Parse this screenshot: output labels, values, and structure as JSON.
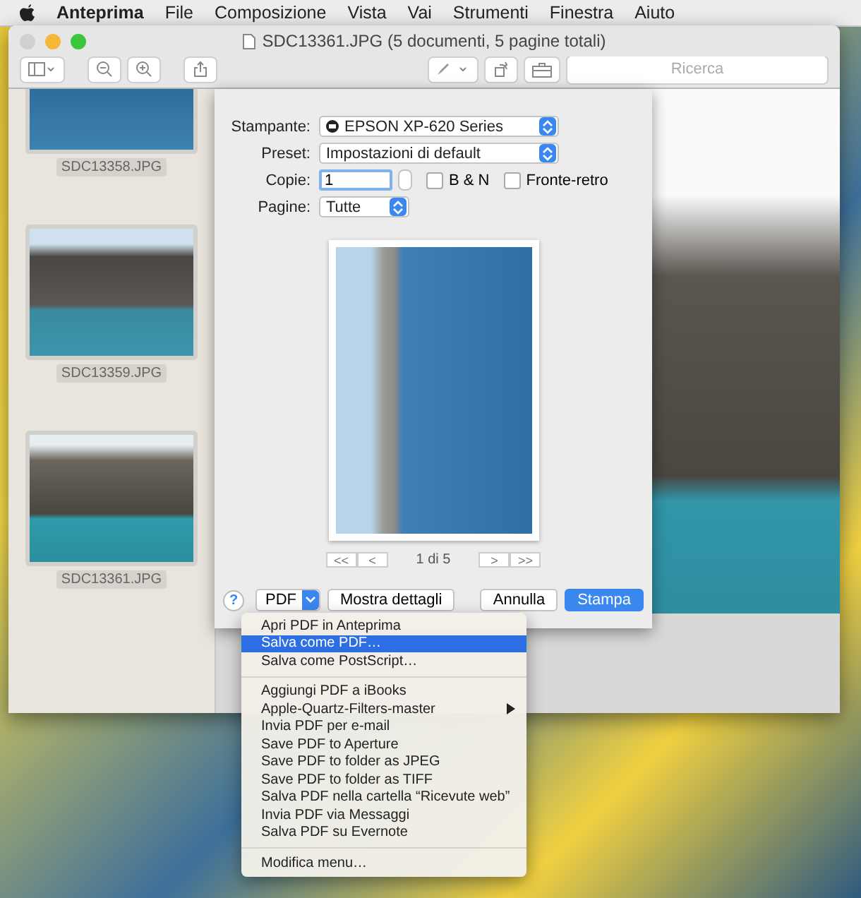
{
  "menubar": {
    "app": "Anteprima",
    "menus": [
      "File",
      "Composizione",
      "Vista",
      "Vai",
      "Strumenti",
      "Finestra",
      "Aiuto"
    ]
  },
  "window": {
    "title": "SDC13361.JPG (5 documenti, 5 pagine totali)",
    "search": {
      "placeholder": "Ricerca"
    }
  },
  "sidebar": {
    "items": [
      {
        "label": "SDC13358.JPG"
      },
      {
        "label": "SDC13359.JPG"
      },
      {
        "label": "SDC13361.JPG"
      }
    ]
  },
  "print": {
    "fields": [
      {
        "label": "Stampante:",
        "kind": "printer",
        "value": "EPSON XP-620 Series"
      },
      {
        "label": "Preset:",
        "kind": "popup",
        "value": "Impostazioni di default"
      },
      {
        "label": "Copie:",
        "kind": "copies",
        "value": "1",
        "checkboxes": [
          {
            "label": "B & N",
            "checked": false
          },
          {
            "label": "Fronte-retro",
            "checked": false
          }
        ]
      },
      {
        "label": "Pagine:",
        "kind": "short",
        "value": "Tutte"
      }
    ],
    "pager": {
      "first": "<<",
      "prev": "<",
      "page": "1 di 5",
      "next": ">",
      "last": ">>"
    },
    "help": "?",
    "pdf": "PDF",
    "details": "Mostra dettagli",
    "cancel": "Annulla",
    "confirm": "Stampa"
  },
  "pdf_menu": {
    "items": [
      {
        "kind": "item",
        "label": "Apri PDF in Anteprima",
        "selected": false,
        "submenu": false
      },
      {
        "kind": "item",
        "label": "Salva come PDF…",
        "selected": true,
        "submenu": false
      },
      {
        "kind": "item",
        "label": "Salva come PostScript…",
        "selected": false,
        "submenu": false
      },
      {
        "kind": "separator"
      },
      {
        "kind": "item",
        "label": "Aggiungi PDF a iBooks",
        "selected": false,
        "submenu": false
      },
      {
        "kind": "item",
        "label": "Apple-Quartz-Filters-master",
        "selected": false,
        "submenu": true
      },
      {
        "kind": "item",
        "label": "Invia PDF per e-mail",
        "selected": false,
        "submenu": false
      },
      {
        "kind": "item",
        "label": "Save PDF to Aperture",
        "selected": false,
        "submenu": false
      },
      {
        "kind": "item",
        "label": "Save PDF to folder as JPEG",
        "selected": false,
        "submenu": false
      },
      {
        "kind": "item",
        "label": "Save PDF to folder as TIFF",
        "selected": false,
        "submenu": false
      },
      {
        "kind": "item",
        "label": "Salva PDF nella cartella “Ricevute web”",
        "selected": false,
        "submenu": false
      },
      {
        "kind": "item",
        "label": "Invia PDF via Messaggi",
        "selected": false,
        "submenu": false
      },
      {
        "kind": "item",
        "label": "Salva PDF su Evernote",
        "selected": false,
        "submenu": false
      },
      {
        "kind": "separator"
      },
      {
        "kind": "item",
        "label": "Modifica menu…",
        "selected": false,
        "submenu": false
      }
    ]
  }
}
